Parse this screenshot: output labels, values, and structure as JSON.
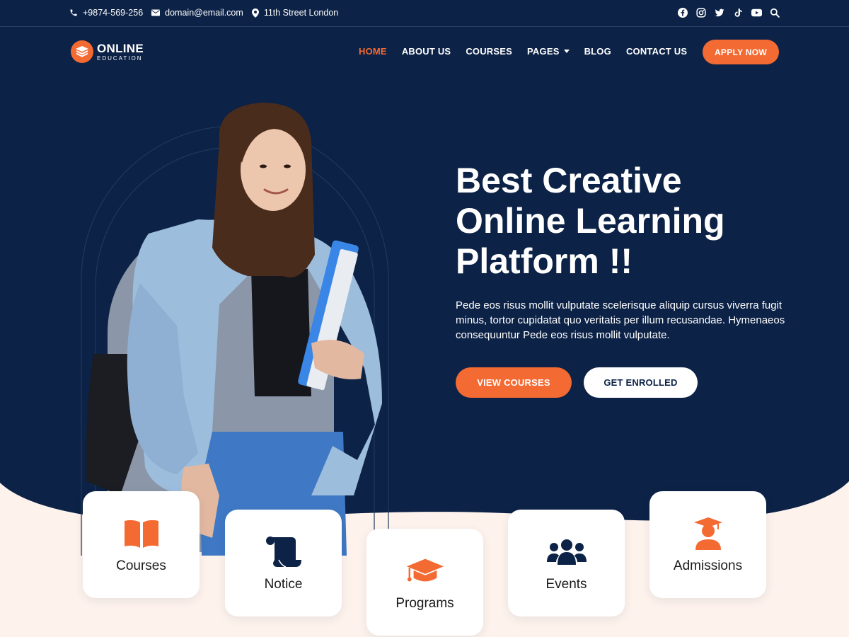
{
  "colors": {
    "navy": "#0c2246",
    "accent": "#f46a33",
    "cream": "#fdf2ec",
    "white": "#ffffff"
  },
  "topbar": {
    "phone": "+9874-569-256",
    "email": "domain@email.com",
    "address": "11th Street London",
    "social_icons": [
      "facebook-icon",
      "instagram-icon",
      "twitter-icon",
      "tiktok-icon",
      "youtube-icon",
      "search-icon"
    ]
  },
  "logo": {
    "main": "ONLINE",
    "sub": "EDUCATION"
  },
  "nav": {
    "items": [
      {
        "label": "HOME",
        "active": true
      },
      {
        "label": "ABOUT US"
      },
      {
        "label": "COURSES"
      },
      {
        "label": "PAGES",
        "dropdown": true
      },
      {
        "label": "BLOG"
      },
      {
        "label": "CONTACT US"
      }
    ],
    "apply_label": "APPLY NOW"
  },
  "hero": {
    "headline": [
      "Best Creative",
      "Online Learning",
      "Platform !!"
    ],
    "description": "Pede eos risus mollit vulputate scelerisque aliquip cursus viverra fugit minus, tortor cupidatat quo veritatis per illum recusandae. Hymenaeos consequuntur Pede eos risus mollit vulputate.",
    "primary_button": "VIEW COURSES",
    "secondary_button": "GET ENROLLED"
  },
  "features": [
    {
      "label": "Courses",
      "icon": "book-icon"
    },
    {
      "label": "Notice",
      "icon": "scroll-icon"
    },
    {
      "label": "Programs",
      "icon": "graduation-cap-icon"
    },
    {
      "label": "Events",
      "icon": "users-icon"
    },
    {
      "label": "Admissions",
      "icon": "graduate-icon"
    }
  ]
}
